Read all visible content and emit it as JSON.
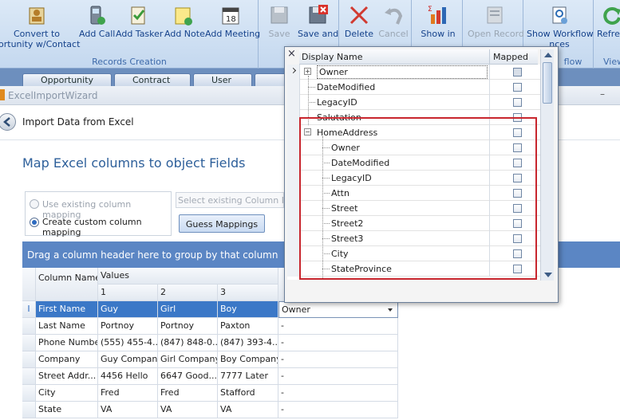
{
  "ribbon": {
    "convert_line1": "Convert to",
    "convert_line2": "ortunity w/Contact",
    "add_call": "Add Call",
    "add_tasker": "Add Tasker",
    "add_note": "Add Note",
    "add_meeting": "Add Meeting",
    "records_creation": "Records Creation",
    "save": "Save",
    "save_and": "Save and",
    "delete": "Delete",
    "cancel": "Cancel",
    "show_in": "Show in",
    "open_record": "Open Record",
    "show_workflow_line1": "Show Workflow",
    "show_workflow_line2": "nces",
    "workflow_group": "flow",
    "refresh": "Refre",
    "view_group": "View"
  },
  "tabs": [
    "Opportunity",
    "Contract",
    "User",
    ""
  ],
  "window": {
    "title": "ExcelImportWizard",
    "minimize": "–"
  },
  "header": {
    "title": "Import Data from Excel"
  },
  "main": {
    "heading": "Map Excel columns to object Fields",
    "use_existing": "Use existing column mapping",
    "create_custom": "Create custom column mapping",
    "select_existing_placeholder": "Select existing Column Map",
    "guess_mappings": "Guess Mappings"
  },
  "grid": {
    "group_hint": "Drag a column header here to group by that column",
    "col_name": "Column Name",
    "values": "Values",
    "col_numbers": [
      "1",
      "2",
      "3"
    ],
    "rows": [
      {
        "name": "First Name",
        "v1": "Guy",
        "v2": "Girl",
        "v3": "Boy",
        "map": "Owner"
      },
      {
        "name": "Last Name",
        "v1": "Portnoy",
        "v2": "Portnoy",
        "v3": "Paxton",
        "map": "-"
      },
      {
        "name": "Phone Number",
        "v1": "(555) 455-4...",
        "v2": "(847) 848-0...",
        "v3": "(847) 393-4...",
        "map": "-"
      },
      {
        "name": "Company",
        "v1": "Guy Company",
        "v2": "Girl Company",
        "v3": "Boy Company",
        "map": "-"
      },
      {
        "name": "Street Addr...",
        "v1": "4456 Hello",
        "v2": "6647 Good...",
        "v3": "7777 Later",
        "map": "-"
      },
      {
        "name": "City",
        "v1": "Fred",
        "v2": "Fred",
        "v3": "Stafford",
        "map": "-"
      },
      {
        "name": "State",
        "v1": "VA",
        "v2": "VA",
        "v3": "VA",
        "map": "-"
      }
    ]
  },
  "popup": {
    "close": "×",
    "col_display": "Display Name",
    "col_mapped": "Mapped",
    "rows": [
      {
        "name": "Owner"
      },
      {
        "name": "DateModified"
      },
      {
        "name": "LegacyID"
      },
      {
        "name": "Salutation"
      },
      {
        "name": "HomeAddress"
      },
      {
        "name": "Owner"
      },
      {
        "name": "DateModified"
      },
      {
        "name": "LegacyID"
      },
      {
        "name": "Attn"
      },
      {
        "name": "Street"
      },
      {
        "name": "Street2"
      },
      {
        "name": "Street3"
      },
      {
        "name": "City"
      },
      {
        "name": "StateProvince"
      }
    ]
  },
  "colors": {
    "highlight_box": "#c8262e",
    "selected_row": "#3b78c7",
    "grid_header": "#5b86c4"
  }
}
